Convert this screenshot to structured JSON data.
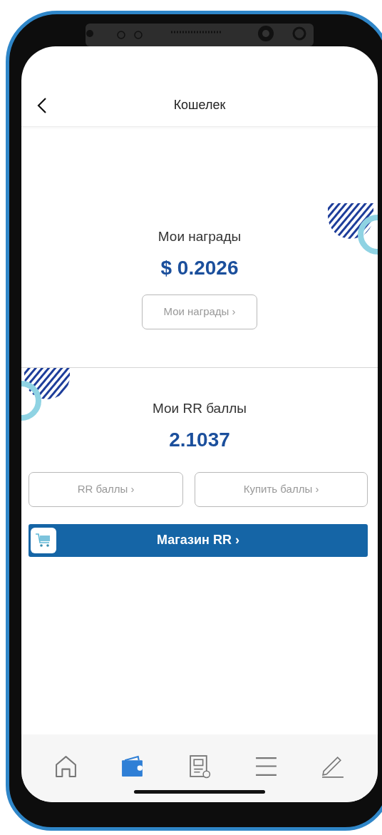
{
  "header": {
    "title": "Кошелек"
  },
  "rewards": {
    "title": "Мои награды",
    "value": "$ 0.2026",
    "button": "Мои награды ›"
  },
  "points": {
    "title": "Мои RR баллы",
    "value": "2.1037",
    "buttons": [
      "RR баллы ›",
      "Купить баллы ›"
    ]
  },
  "store": {
    "label": "Магазин RR ›"
  },
  "tab_bar": [
    {
      "kind": "home",
      "selected": false
    },
    {
      "kind": "wallet",
      "selected": true
    },
    {
      "kind": "document",
      "selected": false
    },
    {
      "kind": "menu",
      "selected": false
    },
    {
      "kind": "edit",
      "selected": false
    }
  ]
}
